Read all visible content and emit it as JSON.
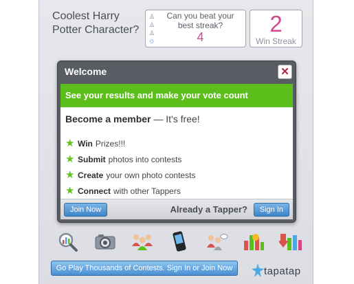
{
  "question": {
    "line1": "Coolest Harry",
    "line2": "Potter Character?"
  },
  "beat_streak": {
    "line1": "Can you beat your",
    "line2": "best streak?",
    "value": "4",
    "progress_icons": [
      "cup-icon",
      "cup-icon",
      "cup-icon",
      "star-icon"
    ]
  },
  "win_streak": {
    "value": "2",
    "label": "Win Streak"
  },
  "modal": {
    "title": "Welcome",
    "close_label": "✕",
    "banner": "See your results and make your vote count",
    "member_bold": "Become a member",
    "member_rest": " — It's free!",
    "benefits": [
      {
        "bold": "Win",
        "rest": "Prizes!!!"
      },
      {
        "bold": "Submit",
        "rest": "photos into contests"
      },
      {
        "bold": "Create",
        "rest": "your own photo contests"
      },
      {
        "bold": "Connect",
        "rest": "with other Tappers"
      }
    ],
    "join_label": "Join Now",
    "already_label": "Already a Tapper?",
    "signin_label": "Sign In"
  },
  "toolbar": {
    "icons": [
      "search-icon",
      "camera-icon",
      "people-icon",
      "phone-icon",
      "chat-people-icon",
      "bar-chart-icon",
      "bar-chart-down-icon"
    ]
  },
  "footer": {
    "play_label": "Go Play Thousands of Contests. Sign In or Join Now",
    "brand": "tapatap"
  },
  "colors": {
    "accent_pink": "#d4478c",
    "banner_green": "#5bbe1a",
    "button_blue": "#3f84c9"
  }
}
